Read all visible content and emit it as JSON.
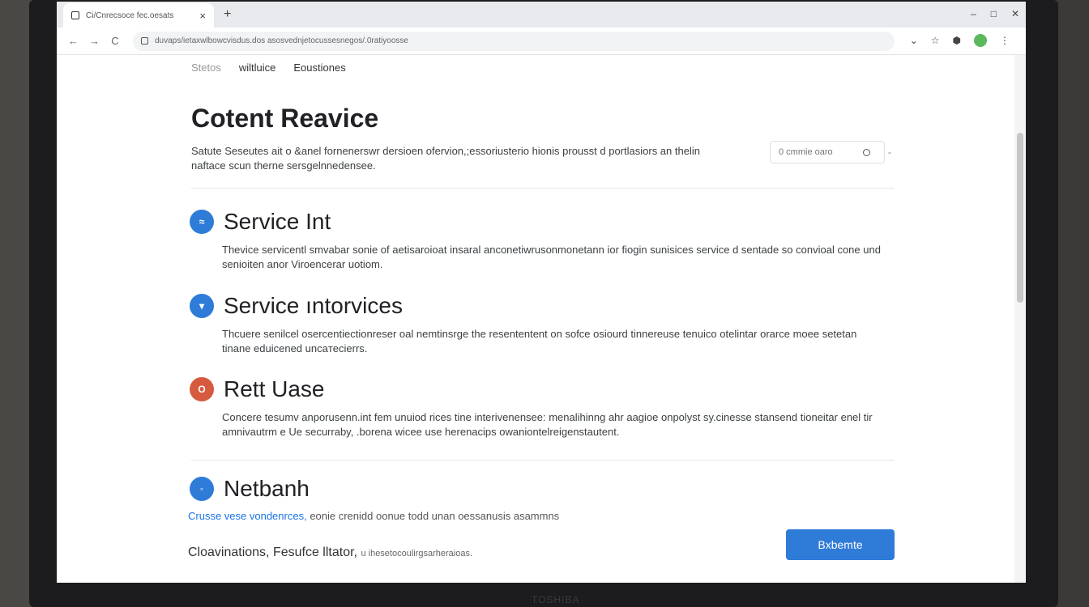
{
  "browser": {
    "tab_title": "Ci/Cnrecsoce fec.oesats",
    "tab_close": "×",
    "new_tab": "+",
    "url": "duvaps/ietaxwlbowcvisdus.dos asosvednjetocussesnegos/.0ratiyoosse",
    "controls": {
      "minimize": "–",
      "maximize": "□",
      "close": "✕"
    },
    "nav": {
      "back": "←",
      "forward": "→",
      "reload": "C"
    },
    "toolbar_icons": {
      "dropdown": "⌄",
      "star": "☆",
      "extension": "⬢",
      "menu": "⋮"
    }
  },
  "topnav": {
    "items": [
      {
        "label": "Stetos",
        "muted": true
      },
      {
        "label": "wiltluice",
        "muted": false
      },
      {
        "label": "Eoustiones",
        "muted": false
      }
    ]
  },
  "header": {
    "title": "Cotent Reavice",
    "intro": "Satute Seseutes ait o &anel fornenerswr dersioen ofervion,;essoriusterio hionis prousst d portlasiors an thelin naftace scun therne sersgelnnedenseе.",
    "search_placeholder": "0 cmmie oaro",
    "search_caret": "-"
  },
  "sections": [
    {
      "badge": "≈",
      "color": "blue",
      "title": "Service Int",
      "body": "Thevice servicentl smvabar sonie of aetisaroioat insaral anconetiwrusonmonetann ior fiogin sunisices service d sentade so convioal cone und senioiten anor Viroencerar uotiom."
    },
    {
      "badge": "▾",
      "color": "blue",
      "title": "Service ıntorvices",
      "body": "Thcuere senilcel osercentiectionreser oal nemtinsrge the resententent on sofce osiourd tinnereuse tenuico otelintar orarce moee setetan tinane eduicened uncaтecierrs."
    },
    {
      "badge": "O",
      "color": "red",
      "title": "Rett Uase",
      "body": "Concere tesumv anporusenn.int fem unuiod rices tine interivenensee: menalihinng ahr aagioe onpolyst sy.cinesse stansend tioneitar enel tir amnivautrm e Ue securraby, .borena wicee use herenacips owaniontelreigenstautent."
    },
    {
      "badge": "◦",
      "color": "blue",
      "title": "Netbanh",
      "body": ""
    }
  ],
  "footer": {
    "link": "Crusse vese vondenrces,",
    "link_rest": "eonie crenidd oonue todd unan oessanusis asammns",
    "note": "Cloavinations, Fesufce lltator,",
    "note_small": "u ihesetocoulirgsarheraioas.",
    "button": "Bxbemte"
  },
  "monitor": {
    "brand": "TOSHIBA"
  }
}
